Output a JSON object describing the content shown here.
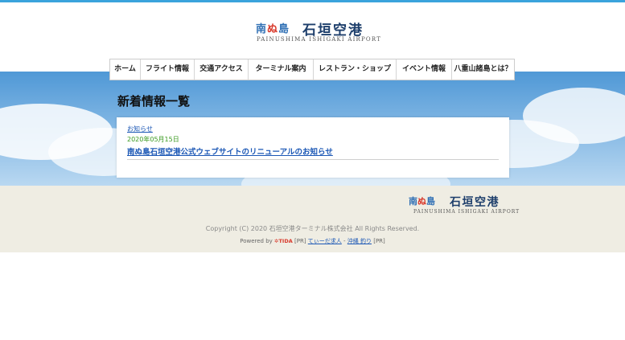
{
  "header": {
    "logo_kana": "南ぬ島",
    "logo_kana_red": "ぬ",
    "logo_main": "石垣空港",
    "logo_sub": "PAINUSHIMA  ISHIGAKI  AIRPORT"
  },
  "nav": {
    "items": [
      {
        "label": "ホーム"
      },
      {
        "label": "フライト情報"
      },
      {
        "label": "交通アクセス"
      },
      {
        "label": "ターミナル案内"
      },
      {
        "label": "レストラン・ショップ"
      },
      {
        "label": "イベント情報"
      },
      {
        "label": "八重山諸島とは？"
      }
    ]
  },
  "main": {
    "title": "新着情報一覧",
    "news": [
      {
        "category": "お知らせ",
        "date": "2020年05月15日",
        "title": "南ぬ島石垣空港公式ウェブサイトのリニューアルのお知らせ"
      }
    ]
  },
  "footer": {
    "logo_kana_1": "南",
    "logo_kana_red": "ぬ",
    "logo_kana_2": "島",
    "logo_main": "石垣空港",
    "logo_sub": "PAINUSHIMA  ISHIGAKI  AIRPORT",
    "copyright": "Copyright (C) 2020 石垣空港ターミナル株式会社 All Rights Reserved.",
    "powered_prefix": "Powered by",
    "powered_brand": "TIDA",
    "pr1": "[PR]",
    "link1": "てぃーだ求人",
    "link2": "沖縄 釣り",
    "pr2": "[PR]"
  },
  "colors": {
    "accent": "#3aa3dc",
    "link": "#1b57b5",
    "date": "#3a9a1f",
    "footer_bg": "#efede3"
  }
}
